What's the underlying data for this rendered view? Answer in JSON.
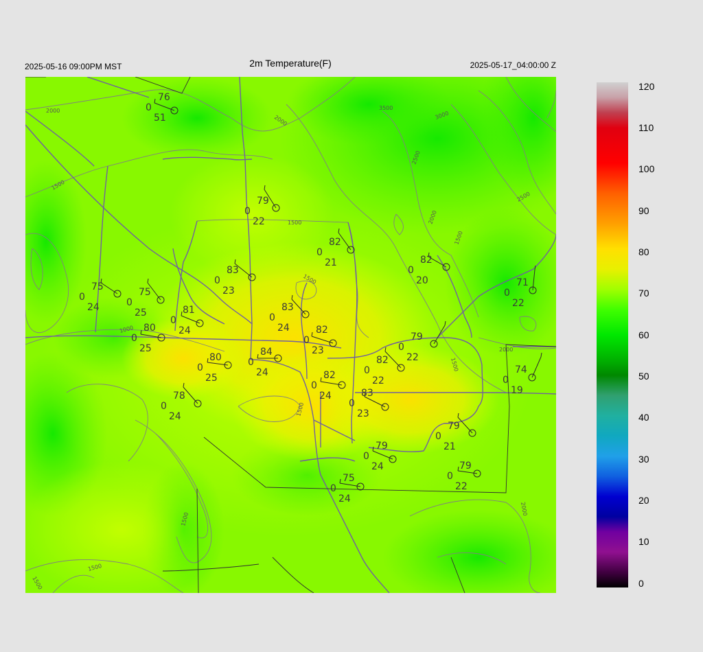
{
  "header": {
    "local_time": "2025-05-16 09:00PM MST",
    "title": "2m Temperature(F)",
    "utc_time": "2025-05-17_04:00:00 Z"
  },
  "colorbar": {
    "labels": [
      "120",
      "110",
      "100",
      "90",
      "80",
      "70",
      "60",
      "50",
      "40",
      "30",
      "20",
      "10",
      "0"
    ],
    "stops": [
      "#c8c8c8",
      "#c0404a",
      "#e00000",
      "#ff8c00",
      "#ffd700",
      "#c8ff00",
      "#00f000",
      "#00a000",
      "#20b0a0",
      "#20a0e0",
      "#0000c0",
      "#8000a0",
      "#000000"
    ]
  },
  "contour_labels": [
    "2000",
    "2000",
    "3500",
    "3000",
    "2500",
    "2500",
    "2000",
    "1500",
    "1500",
    "1500",
    "1500",
    "1000",
    "1500",
    "2000",
    "1500",
    "1500",
    "1500",
    "1500"
  ],
  "stations": [
    {
      "t": "76",
      "p": "0",
      "d": "51"
    },
    {
      "t": "79",
      "p": "0",
      "d": "22"
    },
    {
      "t": "82",
      "p": "0",
      "d": "21"
    },
    {
      "t": "82",
      "p": "0",
      "d": "20"
    },
    {
      "t": "83",
      "p": "0",
      "d": "23"
    },
    {
      "t": "75",
      "p": "0",
      "d": "24"
    },
    {
      "t": "75",
      "p": "0",
      "d": "25"
    },
    {
      "t": "71",
      "p": "0",
      "d": "22"
    },
    {
      "t": "81",
      "p": "0",
      "d": "24"
    },
    {
      "t": "83",
      "p": "0",
      "d": "24"
    },
    {
      "t": "80",
      "p": "0",
      "d": "25"
    },
    {
      "t": "82",
      "p": "0",
      "d": "23"
    },
    {
      "t": "79",
      "p": "0",
      "d": "22"
    },
    {
      "t": "84",
      "p": "0",
      "d": "24"
    },
    {
      "t": "80",
      "p": "0",
      "d": "25"
    },
    {
      "t": "82",
      "p": "0",
      "d": "22"
    },
    {
      "t": "74",
      "p": "0",
      "d": "19"
    },
    {
      "t": "82",
      "p": "0",
      "d": "24"
    },
    {
      "t": "78",
      "p": "0",
      "d": "24"
    },
    {
      "t": "83",
      "p": "0",
      "d": "23"
    },
    {
      "t": "79",
      "p": "0",
      "d": "21"
    },
    {
      "t": "79",
      "p": "0",
      "d": "24"
    },
    {
      "t": "79",
      "p": "0",
      "d": "22"
    },
    {
      "t": "75",
      "p": "0",
      "d": "24"
    }
  ]
}
